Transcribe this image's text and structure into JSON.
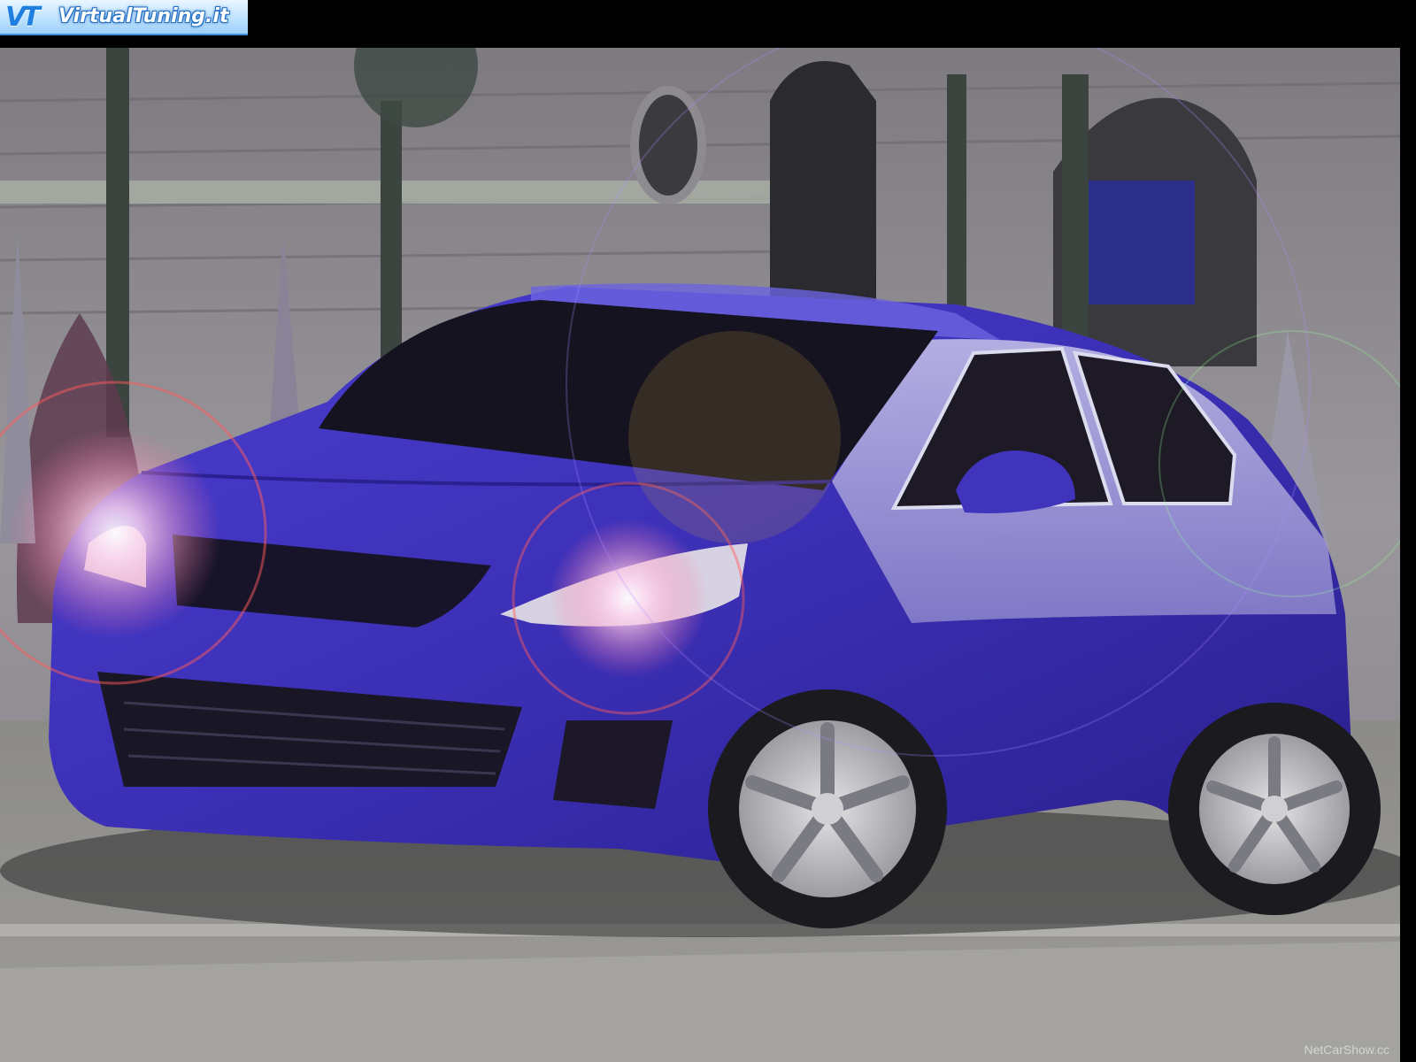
{
  "site_logo": {
    "mark": "VT",
    "text": "VirtualTuning.it"
  },
  "watermark": "NetCarShow.cc",
  "photo": {
    "subject": "car-render",
    "car_color": "#3a2fb0",
    "scene_tone": "#8a8a8a"
  }
}
